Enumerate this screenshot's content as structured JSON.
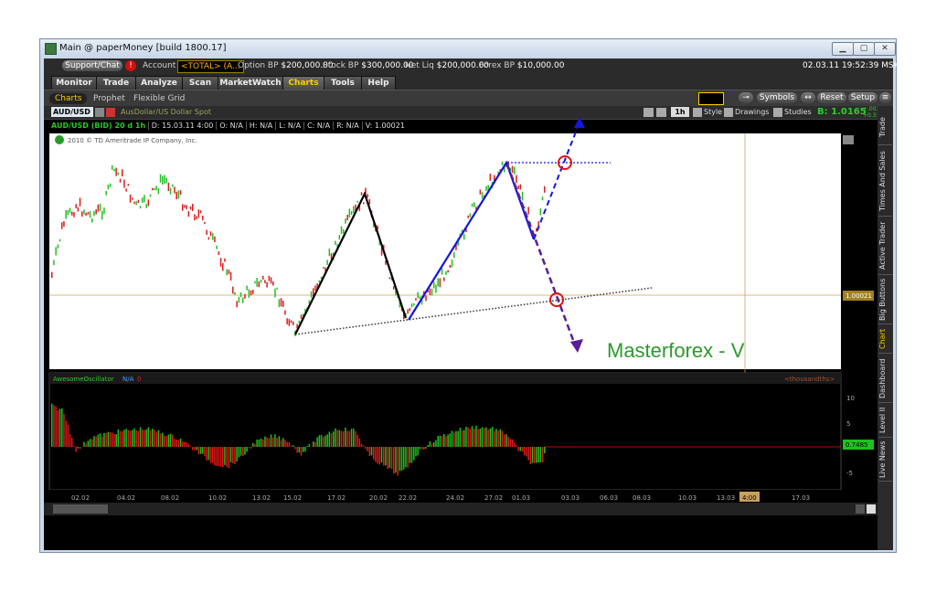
{
  "window": {
    "title": "Main @ paperMoney [build 1800.17]"
  },
  "topbar": {
    "support_label": "Support/Chat",
    "alert_label": "!",
    "account_label": "Account",
    "account_value": "<TOTAL> (A...",
    "option_bp_label": "Option BP",
    "option_bp_value": "$200,000.00",
    "stock_bp_label": "Stock BP",
    "stock_bp_value": "$300,000.00",
    "net_liq_label": "Net Liq",
    "net_liq_value": "$200,000.00",
    "forex_bp_label": "Forex BP",
    "forex_bp_value": "$10,000.00",
    "datetime": "02.03.11 19:52:39 MSK"
  },
  "main_tabs": [
    "Monitor",
    "Trade",
    "Analyze",
    "Scan",
    "MarketWatch",
    "Charts",
    "Tools",
    "Help"
  ],
  "active_tab": "Charts",
  "sub_tabs": [
    "Charts",
    "Prophet",
    "Flexible Grid"
  ],
  "toolbar": {
    "symbols_label": "Symbols",
    "reset_label": "Reset",
    "setup_label": "Setup"
  },
  "chart_header": {
    "symbol": "AUD/USD",
    "description": "AusDollar/US Dollar Spot",
    "timeframe": "1h",
    "style_label": "Style",
    "drawings_label": "Drawings",
    "studies_label": "Studies",
    "bid": "B: 1.0165",
    "change_1": "+.0031",
    "change_2": "+0.31%"
  },
  "info_row": {
    "title": "AUD/USD (BID) 20 d 1h",
    "d": "D: 15.03.11 4:00",
    "o": "O: N/A",
    "h": "H: N/A",
    "l": "L: N/A",
    "c": "C: N/A",
    "r": "R: N/A",
    "v": "V: 1.00021"
  },
  "copyright": "2010 © TD Ameritrade IP Company, Inc.",
  "watermark": "Masterforex - V",
  "price_label": "1.00021",
  "oscillator": {
    "name": "AwesomeOscillator",
    "na": "N/A",
    "zero": "0",
    "units": "<thousandths>",
    "value_label": "0.7485",
    "ticks": [
      "10",
      "5",
      "0",
      "-5"
    ]
  },
  "time_axis": [
    "02.02",
    "04.02",
    "08.02",
    "10.02",
    "13.02",
    "15.02",
    "17.02",
    "20.02",
    "22.02",
    "24.02",
    "27.02",
    "01.03",
    "03.03",
    "06.03",
    "08.03",
    "10.03",
    "13.03",
    "4:00",
    "17.03"
  ],
  "side_tabs": [
    "Trade",
    "Times And Sales",
    "Active Trader",
    "Big Buttons",
    "Chart",
    "Dashboard",
    "Level II",
    "Live News"
  ],
  "colors": {
    "bull": "#1fc01f",
    "bear": "#e01a1a",
    "pattern_black": "#000000",
    "pattern_blue": "#1515e0",
    "pattern_purple": "#5a1e9a",
    "accent": "#ffcc00",
    "watermark": "#2b9a2b"
  }
}
